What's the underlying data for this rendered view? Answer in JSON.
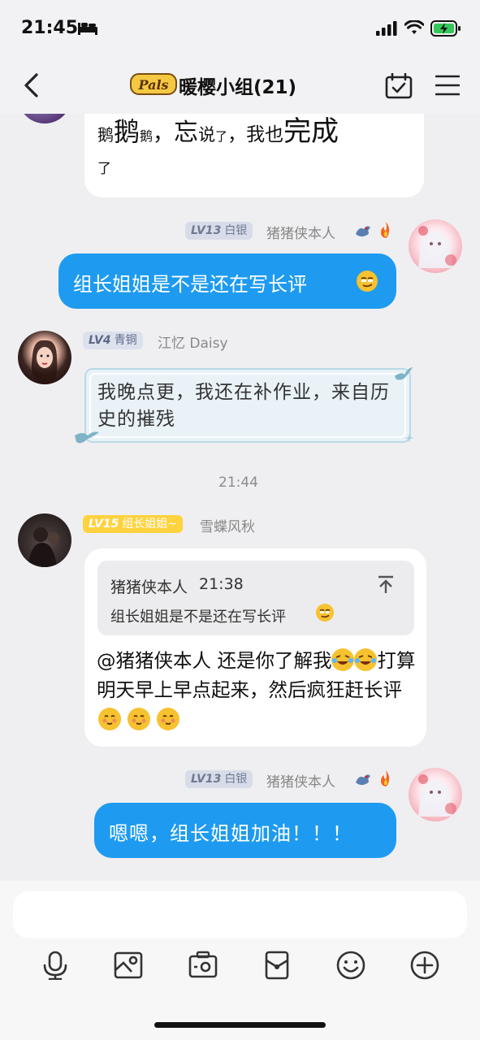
{
  "status": {
    "time": "21:45"
  },
  "header": {
    "title": "暖樱小组(21)",
    "logo_text": "Pals"
  },
  "messages": {
    "m1": {
      "text_a": "鹅",
      "text_b": "鹅",
      "text_c": "鹅",
      "text_d": "，",
      "text_e": "忘",
      "text_f": "说",
      "text_g": "了",
      "text_h": "，我也",
      "text_i": "完成",
      "text_j": "了"
    },
    "m2": {
      "level": "LV13",
      "rank": "白银",
      "user": "猪猪侠本人",
      "text": "组长姐姐是不是还在写长评"
    },
    "m3": {
      "level": "LV4",
      "rank": "青铜",
      "user": "江忆 Daisy",
      "text": "我晚点更，我还在补作业，来自历史的摧残"
    },
    "ts": "21:44",
    "m4": {
      "level": "LV15",
      "rank": "组长姐姐~",
      "user": "雪蝶风秋",
      "quote_user": "猪猪侠本人",
      "quote_time": "21:38",
      "quote_text": "组长姐姐是不是还在写长评",
      "mention": "@猪猪侠本人",
      "text_a": " 还是你了解我",
      "text_b": "打算明天早上早点起来，然后疯狂赶长评"
    },
    "m5": {
      "level": "LV13",
      "rank": "白银",
      "user": "猪猪侠本人",
      "text": "嗯嗯，组长姐姐加油！！！"
    }
  },
  "colors": {
    "blue_bubble": "#1e9bf0",
    "silver_badge": "#d7dce8",
    "bronze_badge": "#dde1ee",
    "gold_badge": "#ffd23f"
  },
  "toolbar": {
    "icons": [
      "microphone-icon",
      "image-icon",
      "camera-icon",
      "red-packet-icon",
      "emoji-icon",
      "plus-icon"
    ]
  }
}
